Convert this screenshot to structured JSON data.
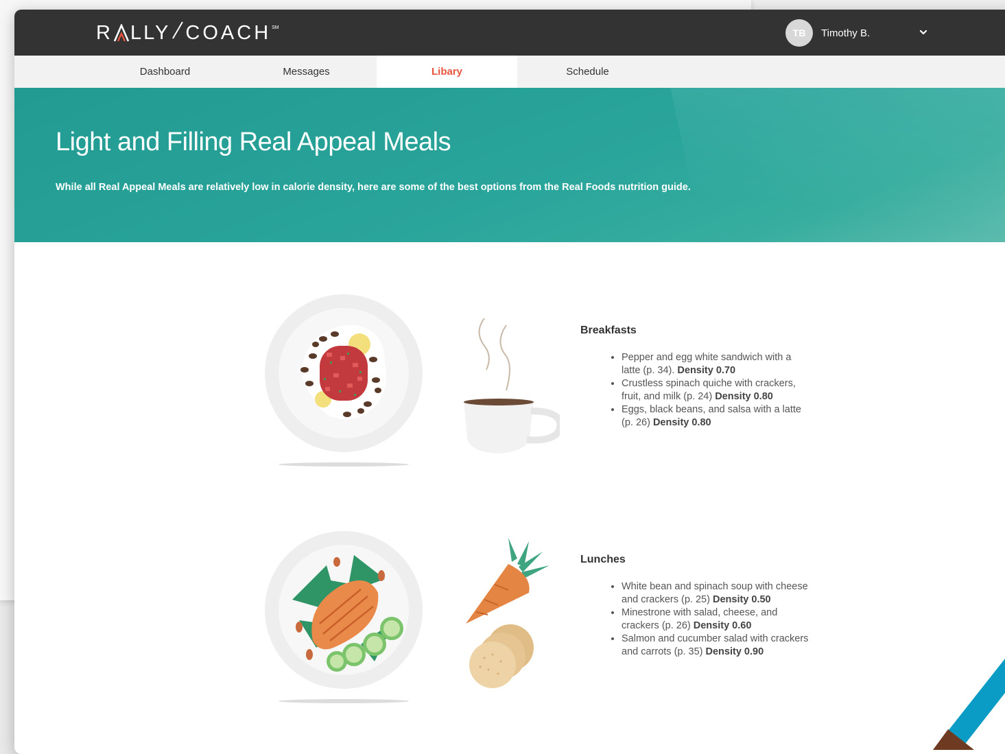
{
  "app": {
    "logo_left": "R",
    "logo_mid": "LLY",
    "logo_right": "COACH",
    "logo_sm": "SM"
  },
  "user": {
    "initials": "TB",
    "name": "Timothy B."
  },
  "tabs": [
    {
      "label": "Dashboard",
      "active": false
    },
    {
      "label": "Messages",
      "active": false
    },
    {
      "label": "Libary",
      "active": true
    },
    {
      "label": "Schedule",
      "active": false
    }
  ],
  "hero": {
    "title": "Light and Filling Real Appeal Meals",
    "subtitle": "While all Real Appeal Meals are relatively low in calorie density, here are some of the best options from the Real Foods nutrition guide."
  },
  "sections": [
    {
      "title": "Breakfasts",
      "items": [
        {
          "text": "Pepper and egg white sandwich with a latte (p. 34).",
          "density": "Density 0.70"
        },
        {
          "text": "Crustless spinach quiche with crackers, fruit, and milk (p. 24)",
          "density": "Density 0.80"
        },
        {
          "text": "Eggs, black beans, and salsa with a latte (p. 26)",
          "density": "Density 0.80"
        }
      ]
    },
    {
      "title": "Lunches",
      "items": [
        {
          "text": "White bean and spinach soup with cheese and crackers (p. 25)",
          "density": "Density 0.50"
        },
        {
          "text": "Minestrone with salad, cheese, and crackers (p. 26)",
          "density": "Density 0.60"
        },
        {
          "text": "Salmon and cucumber salad with crackers and carrots (p. 35)",
          "density": "Density 0.90"
        }
      ]
    }
  ],
  "colors": {
    "topbar": "#333333",
    "accent": "#e8553e",
    "hero": "#2aa59b",
    "corner_blue": "#0a9cc4",
    "corner_brown": "#6e3b22"
  }
}
